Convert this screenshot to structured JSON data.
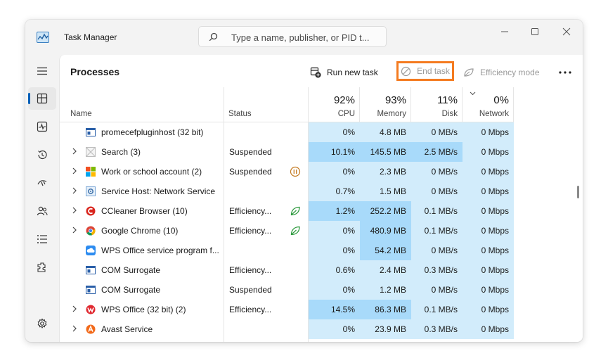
{
  "window": {
    "title": "Task Manager",
    "search_placeholder": "Type a name, publisher, or PID t..."
  },
  "nav": {
    "items": [
      {
        "icon": "hamburger-icon"
      },
      {
        "icon": "processes-icon",
        "active": true
      },
      {
        "icon": "performance-icon"
      },
      {
        "icon": "app-history-icon"
      },
      {
        "icon": "startup-apps-icon"
      },
      {
        "icon": "users-icon"
      },
      {
        "icon": "details-icon"
      },
      {
        "icon": "services-icon"
      },
      {
        "icon": "settings-icon"
      }
    ]
  },
  "toolbar": {
    "page_title": "Processes",
    "run_new_task": "Run new task",
    "end_task": "End task",
    "efficiency_mode": "Efficiency mode"
  },
  "columns": {
    "name": "Name",
    "status": "Status",
    "cpu": {
      "pct": "92%",
      "label": "CPU"
    },
    "memory": {
      "pct": "93%",
      "label": "Memory"
    },
    "disk": {
      "pct": "11%",
      "label": "Disk"
    },
    "network": {
      "pct": "0%",
      "label": "Network"
    }
  },
  "colors": {
    "accent": "#005fb8",
    "highlight_box": "#f47b20",
    "heat_light": "#d2ecfb",
    "heat_medium": "#a8dafa"
  },
  "rows": [
    {
      "name": "promecefpluginhost (32 bit)",
      "status": "",
      "status_icon": "",
      "expand": false,
      "icon": "window-app-icon",
      "cpu": "0%",
      "memory": "4.8 MB",
      "disk": "0 MB/s",
      "network": "0 Mbps",
      "heat": [
        "h1",
        "h1",
        "h1",
        "h1"
      ]
    },
    {
      "name": "Search (3)",
      "status": "Suspended",
      "status_icon": "",
      "expand": true,
      "icon": "search-app-icon",
      "cpu": "10.1%",
      "memory": "145.5 MB",
      "disk": "2.5 MB/s",
      "network": "0 Mbps",
      "heat": [
        "h2",
        "h2",
        "h2",
        "h1"
      ]
    },
    {
      "name": "Work or school account (2)",
      "status": "Suspended",
      "status_icon": "paused-icon",
      "expand": true,
      "icon": "windows-logo-icon",
      "cpu": "0%",
      "memory": "2.3 MB",
      "disk": "0 MB/s",
      "network": "0 Mbps",
      "heat": [
        "h1",
        "h1",
        "h1",
        "h1"
      ]
    },
    {
      "name": "Service Host: Network Service",
      "status": "",
      "status_icon": "",
      "expand": true,
      "icon": "gear-service-icon",
      "cpu": "0.7%",
      "memory": "1.5 MB",
      "disk": "0 MB/s",
      "network": "0 Mbps",
      "heat": [
        "h1",
        "h1",
        "h1",
        "h1"
      ]
    },
    {
      "name": "CCleaner Browser (10)",
      "status": "Efficiency...",
      "status_icon": "leaf-icon",
      "expand": true,
      "icon": "ccleaner-icon",
      "cpu": "1.2%",
      "memory": "252.2 MB",
      "disk": "0.1 MB/s",
      "network": "0 Mbps",
      "heat": [
        "h2",
        "h2",
        "h1",
        "h1"
      ]
    },
    {
      "name": "Google Chrome (10)",
      "status": "Efficiency...",
      "status_icon": "leaf-icon",
      "expand": true,
      "icon": "chrome-icon",
      "cpu": "0%",
      "memory": "480.9 MB",
      "disk": "0.1 MB/s",
      "network": "0 Mbps",
      "heat": [
        "h1",
        "h2",
        "h1",
        "h1"
      ]
    },
    {
      "name": "WPS Office service program f...",
      "status": "",
      "status_icon": "",
      "expand": false,
      "icon": "cloud-app-icon",
      "cpu": "0%",
      "memory": "54.2 MB",
      "disk": "0 MB/s",
      "network": "0 Mbps",
      "heat": [
        "h1",
        "h2",
        "h1",
        "h1"
      ]
    },
    {
      "name": "COM Surrogate",
      "status": "Efficiency...",
      "status_icon": "",
      "expand": false,
      "icon": "window-app-icon",
      "cpu": "0.6%",
      "memory": "2.4 MB",
      "disk": "0.3 MB/s",
      "network": "0 Mbps",
      "heat": [
        "h1",
        "h1",
        "h1",
        "h1"
      ]
    },
    {
      "name": "COM Surrogate",
      "status": "Suspended",
      "status_icon": "",
      "expand": false,
      "icon": "window-app-icon",
      "cpu": "0%",
      "memory": "1.2 MB",
      "disk": "0 MB/s",
      "network": "0 Mbps",
      "heat": [
        "h1",
        "h1",
        "h1",
        "h1"
      ]
    },
    {
      "name": "WPS Office (32 bit) (2)",
      "status": "Efficiency...",
      "status_icon": "",
      "expand": true,
      "icon": "wps-icon",
      "cpu": "14.5%",
      "memory": "86.3 MB",
      "disk": "0.1 MB/s",
      "network": "0 Mbps",
      "heat": [
        "h2",
        "h2",
        "h1",
        "h1"
      ]
    },
    {
      "name": "Avast Service",
      "status": "",
      "status_icon": "",
      "expand": true,
      "icon": "avast-icon",
      "cpu": "0%",
      "memory": "23.9 MB",
      "disk": "0.3 MB/s",
      "network": "0 Mbps",
      "heat": [
        "h1",
        "h1",
        "h1",
        "h1"
      ]
    }
  ]
}
